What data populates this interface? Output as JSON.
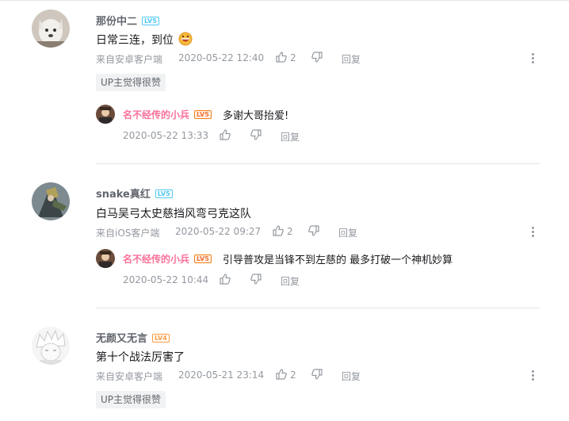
{
  "comments": [
    {
      "username": "那份中二",
      "level": "LV5",
      "text": "日常三连，到位",
      "emoji": "grinning-face-emoji",
      "source": "来自安卓客户端",
      "time": "2020-05-22 12:40",
      "likes": "2",
      "reply_label": "回复",
      "up_tag": "UP主觉得很赞",
      "replies": [
        {
          "username": "名不经传的小兵",
          "level": "LV5",
          "text": "多谢大哥抬爱!",
          "time": "2020-05-22 13:33",
          "reply_label": "回复"
        }
      ]
    },
    {
      "username": "snake真红",
      "level": "LV5",
      "text": "白马吴弓太史慈挡风弯弓克这队",
      "source": "来自iOS客户端",
      "time": "2020-05-22 09:27",
      "likes": "2",
      "reply_label": "回复",
      "replies": [
        {
          "username": "名不经传的小兵",
          "level": "LV5",
          "text": "引导普攻是当锋不到左慈的 最多打破一个神机妙算",
          "time": "2020-05-22 10:44",
          "reply_label": "回复"
        }
      ]
    },
    {
      "username": "无颜又无言",
      "level": "LV4",
      "text": "第十个战法厉害了",
      "source": "来自安卓客户端",
      "time": "2020-05-21 23:14",
      "likes": "2",
      "reply_label": "回复",
      "up_tag": "UP主觉得很赞"
    }
  ],
  "colors": {
    "accent_pink": "#fb7299",
    "level_blue": "#50c8f5",
    "level_orange": "#ff9b3f",
    "meta_gray": "#9499a0"
  }
}
